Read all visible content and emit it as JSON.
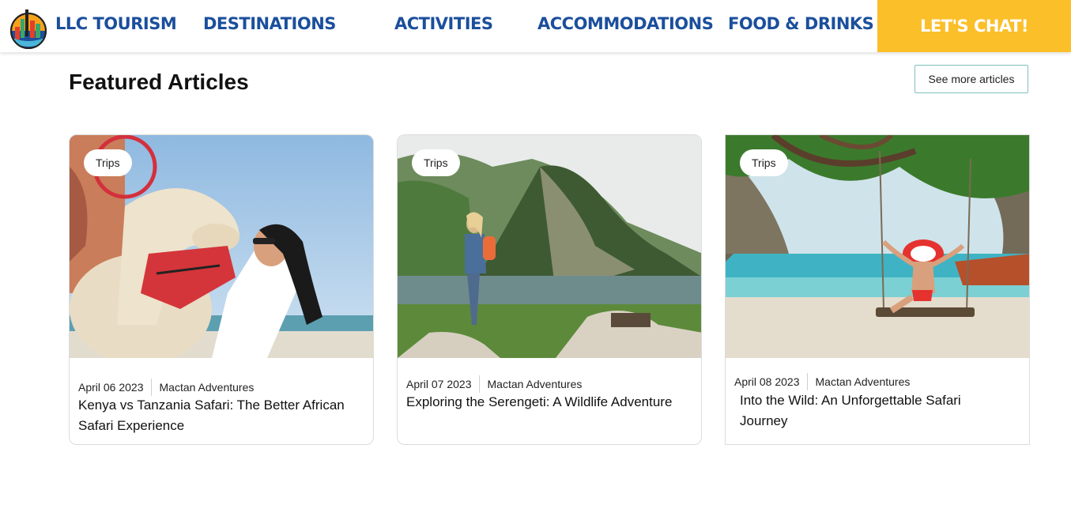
{
  "brand": {
    "name": "LLC TOURISM",
    "logo_icon": "city-globe-logo"
  },
  "nav": {
    "items": [
      {
        "label": "DESTINATIONS"
      },
      {
        "label": "ACTIVITIES"
      },
      {
        "label": "ACCOMMODATIONS"
      },
      {
        "label": "FOOD & DRINKS"
      }
    ],
    "cta_label": "LET'S CHAT!"
  },
  "colors": {
    "nav_text": "#1b4f9c",
    "cta_bg": "#fbbf2a",
    "button_border": "#7fc1bd"
  },
  "section": {
    "title": "Featured Articles",
    "see_more_label": "See more articles"
  },
  "articles": [
    {
      "category": "Trips",
      "date": "April 06 2023",
      "author": "Mactan Adventures",
      "title": "Kenya vs Tanzania Safari: The Better African Safari Experience",
      "image": "woman-kissing-camel-photo"
    },
    {
      "category": "Trips",
      "date": "April 07 2023",
      "author": "Mactan Adventures",
      "title": "Exploring the Serengeti: A Wildlife Adventure",
      "image": "hiker-mountain-lake-photo"
    },
    {
      "category": "Trips",
      "date": "April 08 2023",
      "author": "Mactan Adventures",
      "title": "Into the Wild: An Unforgettable Safari Journey",
      "image": "woman-beach-swing-photo"
    }
  ]
}
